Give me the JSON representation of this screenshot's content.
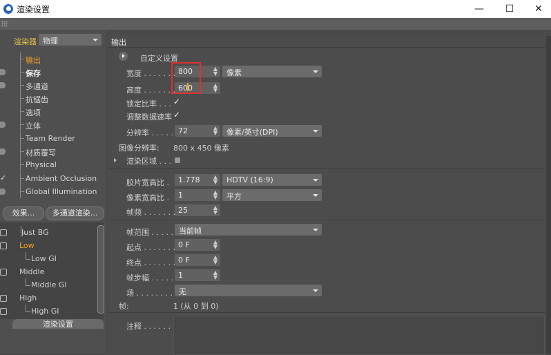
{
  "window": {
    "title": "渲染设置",
    "minimize": "—",
    "maximize": "☐",
    "close": "✕"
  },
  "left": {
    "renderer_label": "渲染器",
    "renderer_value": "物理",
    "items": [
      {
        "label": "输出",
        "state": "active"
      },
      {
        "label": "保存",
        "state": "bold"
      },
      {
        "label": "多通道",
        "state": ""
      },
      {
        "label": "抗锯齿",
        "state": ""
      },
      {
        "label": "选项",
        "state": ""
      },
      {
        "label": "立体",
        "state": ""
      },
      {
        "label": "Team Render",
        "state": ""
      },
      {
        "label": "材质覆写",
        "state": ""
      },
      {
        "label": "Physical",
        "state": ""
      },
      {
        "label": "Ambient Occlusion",
        "state": ""
      },
      {
        "label": "Global Illumination",
        "state": ""
      }
    ],
    "effects_button": "效果...",
    "multipass_button": "多通道渲染...",
    "presets": [
      {
        "label": "Just BG"
      },
      {
        "label": "Low"
      },
      {
        "label": "Low GI"
      },
      {
        "label": "Middle"
      },
      {
        "label": "Middle GI"
      },
      {
        "label": "High"
      },
      {
        "label": "High GI"
      }
    ],
    "bottom_button": "渲染设置"
  },
  "main": {
    "section_title": "输出",
    "preset_label": "自定义设置",
    "width_label": "宽度 . . . . . . .",
    "width_value": "800",
    "unit_value": "像素",
    "height_label": "高度 . . . . . . .",
    "height_value": "600",
    "lock_ratio_label": "锁定比率 . . .",
    "adjust_rate_label": "调整数据速率",
    "check": "✓",
    "resolution_label": "分辨率 . . . . .",
    "resolution_value": "72",
    "resolution_unit": "像素/英寸(DPI)",
    "image_res_label": "图像分辨率:",
    "image_res_value": "800 x 450 像素",
    "render_region_label": "渲染区域 . . .",
    "film_aspect_label": "胶片宽高比 .",
    "film_aspect_value": "1.778",
    "film_aspect_preset": "HDTV (16:9)",
    "pixel_aspect_label": "像素宽高比 .",
    "pixel_aspect_value": "1",
    "pixel_aspect_preset": "平方",
    "fps_label": "帧频 . . . . . . .",
    "fps_value": "25",
    "frame_range_label": "帧范围 . . . . .",
    "frame_range_value": "当前帧",
    "start_label": "起点 . . . . . . .",
    "start_value": "0 F",
    "end_label": "终点 . . . . . . .",
    "end_value": "0 F",
    "step_label": "帧步幅 . . . . .",
    "step_value": "1",
    "field_label": "场 . . . . . . . . .",
    "field_value": "无",
    "frames_label": "帧:",
    "frames_value": "1 (从 0 到 0)",
    "notes_label": "注释 . . . . . . ."
  }
}
